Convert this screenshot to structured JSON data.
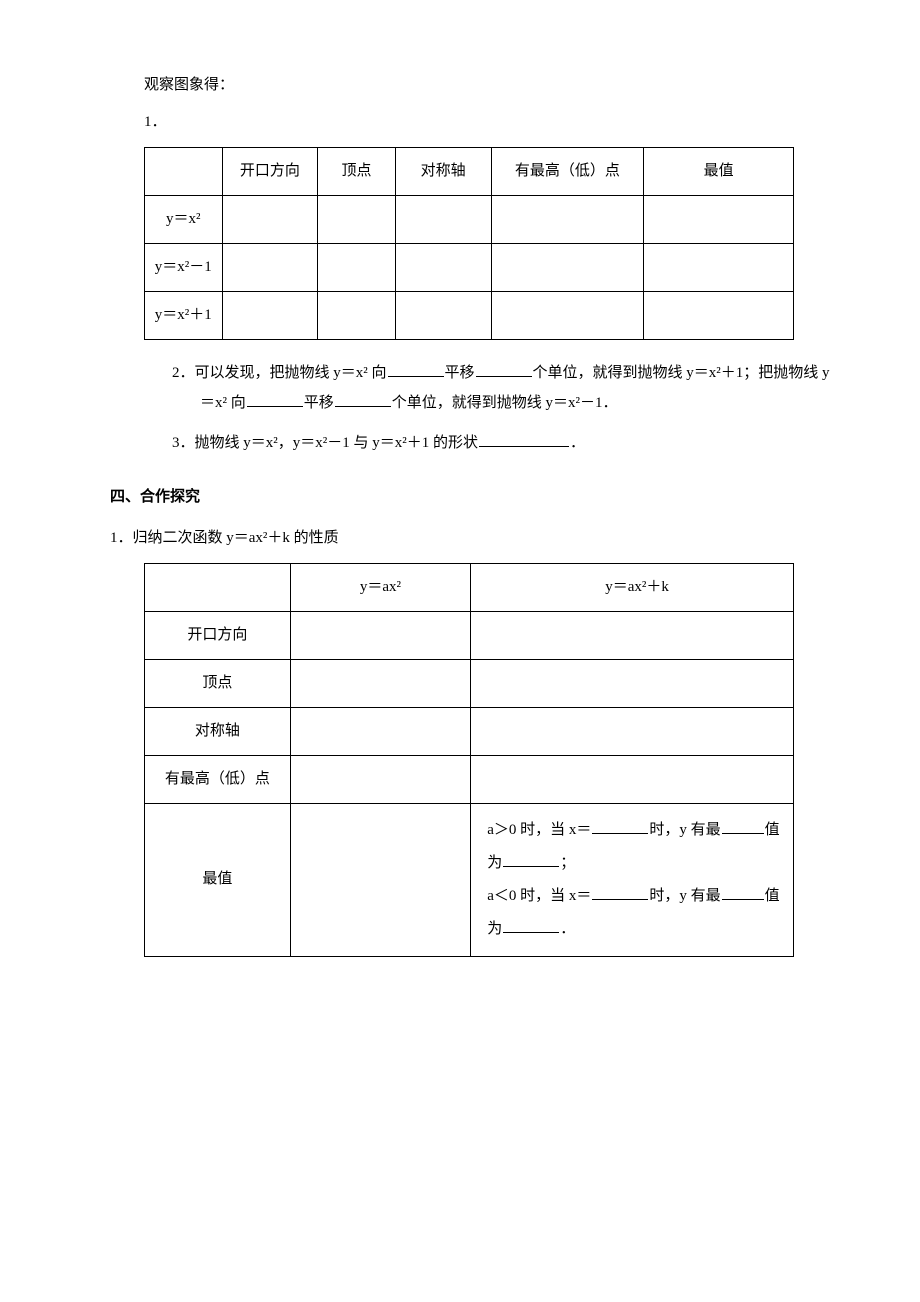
{
  "intro": {
    "observe": "观察图象得：",
    "num1": "1．"
  },
  "table1": {
    "headers": {
      "blank": "",
      "dir": "开口方向",
      "vertex": "顶点",
      "axis": "对称轴",
      "hl": "有最高（低）点",
      "ext": "最值"
    },
    "rows": [
      {
        "fn": "y＝x²"
      },
      {
        "fn": "y＝x²－1"
      },
      {
        "fn": "y＝x²＋1"
      }
    ]
  },
  "q2": {
    "prefix": "2．可以发现，把抛物线 y＝x² 向",
    "mid1": "平移",
    "mid2": "个单位，就得到抛物线 y＝x²＋1；把抛物线 y＝x² 向",
    "mid3": "平移",
    "mid4": "个单位，就得到抛物线 y＝x²－1．"
  },
  "q3": {
    "prefix": "3．抛物线 y＝x²，y＝x²－1 与 y＝x²＋1 的形状",
    "suffix": "．"
  },
  "section4": {
    "title": "四、合作探究",
    "sub1": "1．归纳二次函数 y＝ax²＋k 的性质"
  },
  "table2": {
    "headers": {
      "blank": "",
      "col1": "y＝ax²",
      "col2": "y＝ax²＋k"
    },
    "rows": {
      "dir": "开口方向",
      "vertex": "顶点",
      "axis": "对称轴",
      "hl": "有最高（低）点",
      "ext": "最值"
    },
    "extcell": {
      "l1a": "a＞0 时，当 x＝",
      "l1b": "时，y 有最",
      "l1c": "值为",
      "l1d": "；",
      "l2a": "a＜0 时，当 x＝",
      "l2b": "时，y 有最",
      "l2c": "值为",
      "l2d": "．"
    }
  }
}
